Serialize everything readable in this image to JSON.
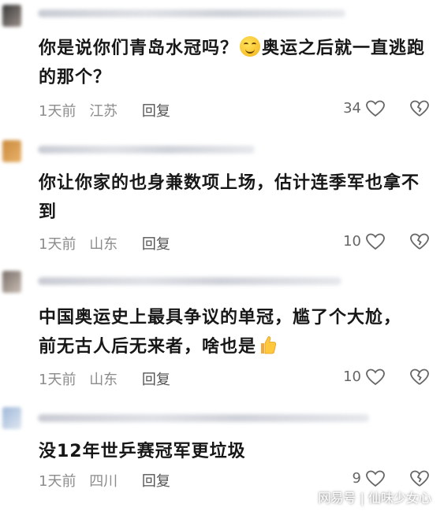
{
  "comments": [
    {
      "text_before_emoji": "你是说你们青岛水冠吗？",
      "text_after_emoji": "奥运之后就一直逃跑的那个？",
      "time": "1天前",
      "location": "江苏",
      "reply_label": "回复",
      "likes": "34",
      "emoji": "smile-emoji"
    },
    {
      "text_before_emoji": "你让你家的也身兼数项上场，估计连季军也拿不到",
      "text_after_emoji": "",
      "time": "1天前",
      "location": "山东",
      "reply_label": "回复",
      "likes": "10"
    },
    {
      "text_before_emoji": "中国奥运史上最具争议的单冠，尴了个大尬，前无古人后无来者，啥也是",
      "text_after_emoji": "",
      "time": "1天前",
      "location": "山东",
      "reply_label": "回复",
      "likes": "10",
      "emoji": "thumbs-up-emoji"
    },
    {
      "text_before_emoji": "没12年世乒赛冠军更垃圾",
      "text_after_emoji": "",
      "time": "1天前",
      "location": "四川",
      "reply_label": "回复",
      "likes": "9"
    }
  ],
  "watermark": "网易号 | 仙味少女心",
  "colors": {
    "text": "#171717",
    "meta": "#8c8c8c",
    "icon": "#666666"
  }
}
